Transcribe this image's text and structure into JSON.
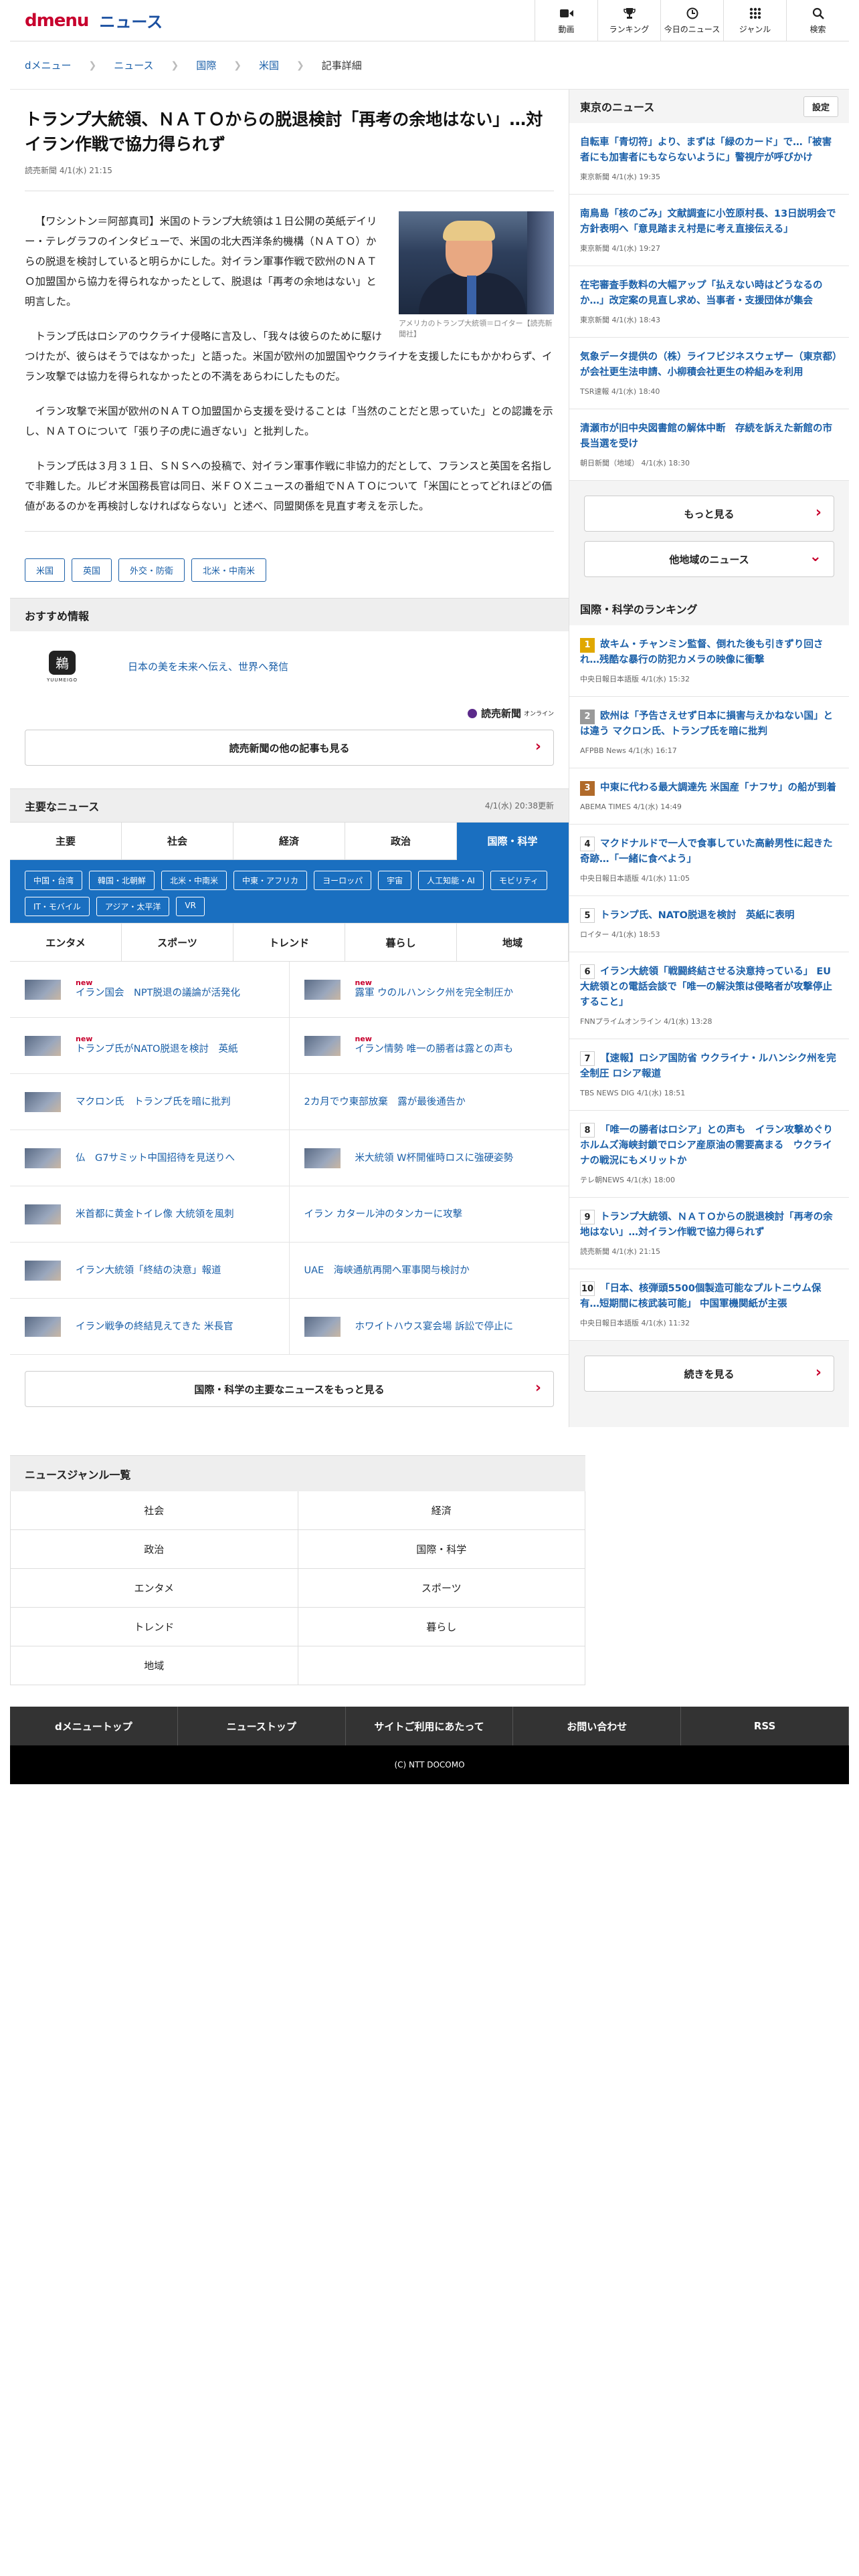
{
  "header": {
    "logo_d": "dmenu",
    "logo_news": "ニュース",
    "nav": [
      {
        "label": "動画",
        "icon": "video-icon"
      },
      {
        "label": "ランキング",
        "icon": "trophy-icon"
      },
      {
        "label": "今日のニュース",
        "icon": "clock-icon"
      },
      {
        "label": "ジャンル",
        "icon": "grid-icon"
      },
      {
        "label": "検索",
        "icon": "search-icon"
      }
    ]
  },
  "breadcrumb": [
    "dメニュー",
    "ニュース",
    "国際",
    "米国",
    "記事詳細"
  ],
  "article": {
    "title": "トランプ大統領、ＮＡＴＯからの脱退検討「再考の余地はない」…対イラン作戦で協力得られず",
    "meta": "読売新聞 4/1(水) 21:15",
    "photo_caption": "アメリカのトランプ大統領＝ロイター【読売新聞社】",
    "paragraphs": [
      "【ワシントン＝阿部真司】米国のトランプ大統領は１日公開の英紙デイリー・テレグラフのインタビューで、米国の北大西洋条約機構（ＮＡＴＯ）からの脱退を検討していると明らかにした。対イラン軍事作戦で欧州のＮＡＴＯ加盟国から協力を得られなかったとして、脱退は「再考の余地はない」と明言した。",
      "トランプ氏はロシアのウクライナ侵略に言及し、「我々は彼らのために駆けつけたが、彼らはそうではなかった」と語った。米国が欧州の加盟国やウクライナを支援したにもかかわらず、イラン攻撃では協力を得られなかったとの不満をあらわにしたものだ。",
      "イラン攻撃で米国が欧州のＮＡＴＯ加盟国から支援を受けることは「当然のことだと思っていた」との認識を示し、ＮＡＴＯについて「張り子の虎に過ぎない」と批判した。",
      "トランプ氏は３月３１日、ＳＮＳへの投稿で、対イラン軍事作戦に非協力的だとして、フランスと英国を名指しで非難した。ルビオ米国務長官は同日、米ＦＯＸニュースの番組でＮＡＴＯについて「米国にとってどれほどの価値があるのかを再検討しなければならない」と述べ、同盟関係を見直す考えを示した。"
    ],
    "tags": [
      "米国",
      "英国",
      "外交・防衛",
      "北米・中南米"
    ]
  },
  "recommend": {
    "heading": "おすすめ情報",
    "logo_text": "YUUMEIGO",
    "text": "日本の美を未来へ伝え、世界へ発信",
    "yomiuri": "読売新聞",
    "yomiuri_sub": "オンライン",
    "more": "読売新聞の他の記事も見る"
  },
  "major": {
    "heading": "主要なニュース",
    "updated": "4/1(水) 20:38更新",
    "tabs": [
      "主要",
      "社会",
      "経済",
      "政治",
      "国際・科学"
    ],
    "subtags": [
      "中国・台湾",
      "韓国・北朝鮮",
      "北米・中南米",
      "中東・アフリカ",
      "ヨーロッパ",
      "宇宙",
      "人工知能・AI",
      "モビリティ",
      "IT・モバイル",
      "アジア・太平洋",
      "VR"
    ],
    "tabs2": [
      "エンタメ",
      "スポーツ",
      "トレンド",
      "暮らし",
      "地域"
    ],
    "items": [
      {
        "title": "イラン国会　NPT脱退の議論が活発化",
        "new": "new",
        "thumb": true
      },
      {
        "title": "露軍 ウのルハンシク州を完全制圧か",
        "new": "new",
        "thumb": true
      },
      {
        "title": "トランプ氏がNATO脱退を検討　英紙",
        "new": "new",
        "thumb": true
      },
      {
        "title": "イラン情勢 唯一の勝者は露との声も",
        "new": "new",
        "thumb": true
      },
      {
        "title": "マクロン氏　トランプ氏を暗に批判",
        "new": "",
        "thumb": true
      },
      {
        "title": "2カ月でウ東部放棄　露が最後通告か",
        "new": "",
        "thumb": false
      },
      {
        "title": "仏　G7サミット中国招待を見送りへ",
        "new": "",
        "thumb": true
      },
      {
        "title": "米大統領 W杯開催時ロスに強硬姿勢",
        "new": "",
        "thumb": true
      },
      {
        "title": "米首都に黄金トイレ像 大統領を風刺",
        "new": "",
        "thumb": true
      },
      {
        "title": "イラン カタール沖のタンカーに攻撃",
        "new": "",
        "thumb": false
      },
      {
        "title": "イラン大統領「終結の決意」報道",
        "new": "",
        "thumb": true
      },
      {
        "title": "UAE　海峡通航再開へ軍事関与検討か",
        "new": "",
        "thumb": false
      },
      {
        "title": "イラン戦争の終結見えてきた 米長官",
        "new": "",
        "thumb": true
      },
      {
        "title": "ホワイトハウス宴会場 訴訟で停止に",
        "new": "",
        "thumb": true
      }
    ],
    "more": "国際・科学の主要なニュースをもっと見る"
  },
  "sidebar": {
    "tokyo_heading": "東京のニュース",
    "settings": "設定",
    "tokyo": [
      {
        "title": "自転車「青切符」より、まずは「緑のカード」で…「被害者にも加害者にもならないように」警視庁が呼びかけ",
        "meta": "東京新聞 4/1(水) 19:35"
      },
      {
        "title": "南鳥島「核のごみ」文献調査に小笠原村長、13日説明会で方針表明へ「意見踏まえ村是に考え直接伝える」",
        "meta": "東京新聞 4/1(水) 19:27"
      },
      {
        "title": "在宅審査手数料の大幅アップ「払えない時はどうなるのか…」改定案の見直し求め、当事者・支援団体が集会",
        "meta": "東京新聞 4/1(水) 18:43"
      },
      {
        "title": "気象データ提供の（株）ライフビジネスウェザー（東京都）が会社更生法申請、小柳積会社更生の枠組みを利用",
        "meta": "TSR速報 4/1(水) 18:40"
      },
      {
        "title": "清瀬市が旧中央図書館の解体中断　存続を訴えた新館の市長当選を受け",
        "meta": "朝日新聞（地域） 4/1(水) 18:30"
      }
    ],
    "tokyo_more": "もっと見る",
    "other_region": "他地域のニュース",
    "rank_heading": "国際・科学のランキング",
    "ranking": [
      {
        "n": "1",
        "color": "#e0a800",
        "title": "故キム・チャンミン監督、倒れた後も引きずり回され…残酷な暴行の防犯カメラの映像に衝撃",
        "meta": "中央日報日本語版 4/1(水) 15:32"
      },
      {
        "n": "2",
        "color": "#9a9a9a",
        "title": "欧州は「予告さえせず日本に損害与えかねない国」とは違う マクロン氏、トランプ氏を暗に批判",
        "meta": "AFPBB News 4/1(水) 16:17"
      },
      {
        "n": "3",
        "color": "#b06a2a",
        "title": "中東に代わる最大調達先 米国産「ナフサ」の船が到着",
        "meta": "ABEMA TIMES 4/1(水) 14:49"
      },
      {
        "n": "4",
        "color": "#fff",
        "title": "マクドナルドで一人で食事していた高齢男性に起きた奇跡…「一緒に食べよう」",
        "meta": "中央日報日本語版 4/1(水) 11:05"
      },
      {
        "n": "5",
        "color": "#fff",
        "title": "トランプ氏、NATO脱退を検討　英紙に表明",
        "meta": "ロイター 4/1(水) 18:53"
      },
      {
        "n": "6",
        "color": "#fff",
        "title": "イラン大統領「戦闘終結させる決意持っている」 EU大統領との電話会談で「唯一の解決策は侵略者が攻撃停止すること」",
        "meta": "FNNプライムオンライン 4/1(水) 13:28"
      },
      {
        "n": "7",
        "color": "#fff",
        "title": "【速報】ロシア国防省 ウクライナ・ルハンシク州を完全制圧 ロシア報道",
        "meta": "TBS NEWS DIG 4/1(水) 18:51"
      },
      {
        "n": "8",
        "color": "#fff",
        "title": "「唯一の勝者はロシア」との声も　イラン攻撃めぐり　ホルムズ海峡封鎖でロシア産原油の需要高まる　ウクライナの戦況にもメリットか",
        "meta": "テレ朝NEWS 4/1(水) 18:00"
      },
      {
        "n": "9",
        "color": "#fff",
        "title": "トランプ大統領、ＮＡＴＯからの脱退検討「再考の余地はない」…対イラン作戦で協力得られず",
        "meta": "読売新聞 4/1(水) 21:15"
      },
      {
        "n": "10",
        "color": "#fff",
        "title": "「日本、核弾頭5500個製造可能なプルトニウム保有…短期間に核武装可能」 中国軍機関紙が主張",
        "meta": "中央日報日本語版 4/1(水) 11:32"
      }
    ],
    "rank_more": "続きを見る"
  },
  "genre": {
    "heading": "ニュースジャンル一覧",
    "items": [
      "社会",
      "経済",
      "政治",
      "国際・科学",
      "エンタメ",
      "スポーツ",
      "トレンド",
      "暮らし",
      "地域",
      ""
    ]
  },
  "footer": {
    "links": [
      "dメニュートップ",
      "ニューストップ",
      "サイトご利用にあたって",
      "お問い合わせ",
      "RSS"
    ],
    "copyright": "(C) NTT DOCOMO"
  }
}
